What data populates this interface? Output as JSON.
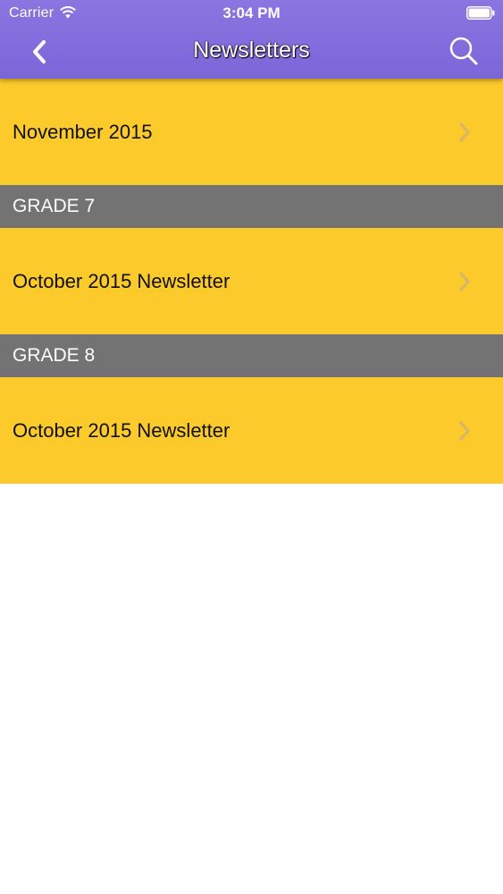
{
  "status_bar": {
    "carrier": "Carrier",
    "time": "3:04 PM",
    "wifi_icon": "wifi-icon",
    "battery_icon": "battery-icon"
  },
  "nav": {
    "title": "Newsletters",
    "back_icon": "chevron-left-icon",
    "search_icon": "search-icon"
  },
  "list": {
    "item_1": {
      "label": "November 2015"
    },
    "section_grade7": {
      "label": "GRADE 7"
    },
    "item_2": {
      "label": "October 2015 Newsletter"
    },
    "section_grade8": {
      "label": "GRADE 8"
    },
    "item_3": {
      "label": "October 2015 Newsletter"
    }
  },
  "colors": {
    "nav_bar": "#7a66d8",
    "row_background": "#fdca2c",
    "section_background": "#737373",
    "page_background": "#ffffff"
  }
}
